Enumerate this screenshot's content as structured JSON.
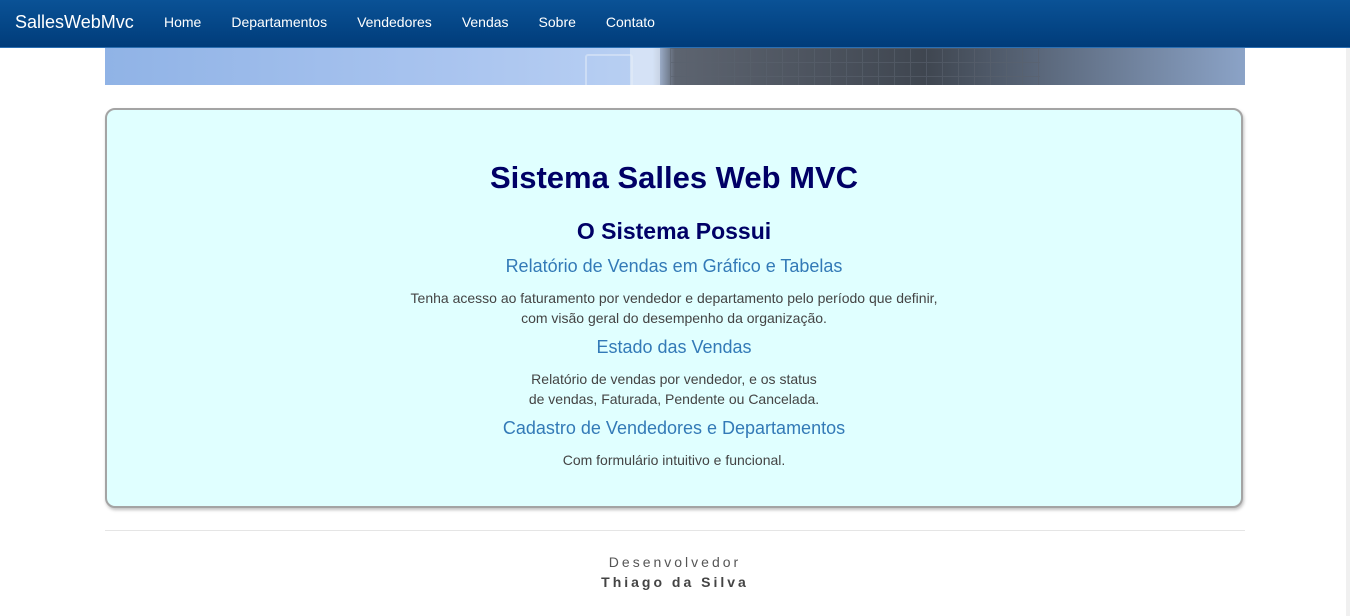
{
  "navbar": {
    "brand": "SallesWebMvc",
    "items": [
      "Home",
      "Departamentos",
      "Vendedores",
      "Vendas",
      "Sobre",
      "Contato"
    ]
  },
  "panel": {
    "title": "Sistema Salles Web MVC",
    "subtitle": "O Sistema Possui",
    "features": [
      {
        "heading": "Relatório de Vendas em Gráfico e Tabelas",
        "line1": "Tenha acesso ao faturamento por vendedor e departamento pelo período que definir,",
        "line2": "com visão geral do desempenho da organização."
      },
      {
        "heading": "Estado das Vendas",
        "line1": "Relatório de vendas por vendedor, e os status",
        "line2": "de vendas, Faturada, Pendente ou Cancelada."
      },
      {
        "heading": "Cadastro de Vendedores e Departamentos",
        "line1": "Com formulário intuitivo e funcional."
      }
    ]
  },
  "footer": {
    "role": "Desenvolvedor",
    "name": "Thiago da Silva"
  },
  "colors": {
    "navbar": "#003c7a",
    "panel_bg": "#e0ffff",
    "title": "#000066",
    "feature_heading": "#337ab7"
  }
}
